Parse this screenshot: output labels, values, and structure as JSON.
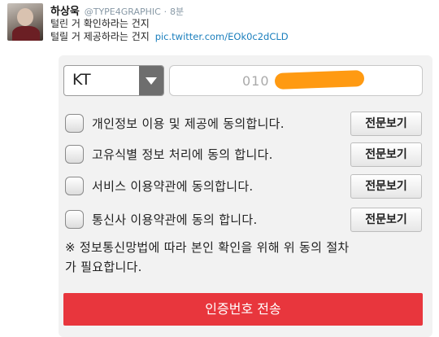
{
  "tweet": {
    "author_name": "하상욱",
    "author_handle": "@TYPE4GRAPHIC",
    "separator": "·",
    "time": "8분",
    "line1": "털린 거 확인하라는 건지",
    "line2": "털릴 거 제공하라는 건지",
    "link": "pic.twitter.com/EOk0c2dCLD"
  },
  "form": {
    "carrier": {
      "selected": "KT"
    },
    "phone": {
      "value": "010"
    },
    "consents": [
      {
        "label": "개인정보 이용 및 제공에 동의합니다.",
        "button": "전문보기"
      },
      {
        "label": "고유식별 정보 처리에 동의 합니다.",
        "button": "전문보기"
      },
      {
        "label": "서비스 이용약관에 동의합니다.",
        "button": "전문보기"
      },
      {
        "label": "통신사 이용약관에 동의 합니다.",
        "button": "전문보기"
      }
    ],
    "notice_line1": "※ 정보통신망법에 따라 본인 확인을 위해 위 동의 절차",
    "notice_line2": "가 필요합니다.",
    "submit_label": "인증번호 전송"
  },
  "colors": {
    "submit_bg": "#e8363d",
    "redaction": "#ff9a12",
    "link": "#1b7fbd"
  }
}
